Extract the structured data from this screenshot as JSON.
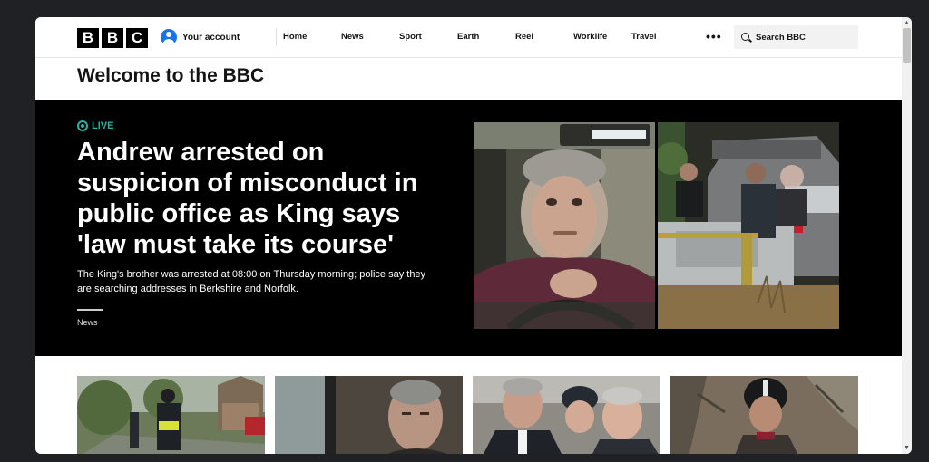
{
  "logo": {
    "letters": [
      "B",
      "B",
      "C"
    ]
  },
  "account": {
    "label": "Your account"
  },
  "nav": {
    "links": [
      "Home",
      "News",
      "Sport",
      "Earth",
      "Reel",
      "Worklife",
      "Travel"
    ],
    "more_label": "•••",
    "search_placeholder": "Search BBC"
  },
  "welcome": "Welcome to the BBC",
  "hero": {
    "live_label": "LIVE",
    "headline": "Andrew arrested on suspicion of misconduct in public office as King says 'law must take its course'",
    "summary": "The King's brother was arrested at 08:00 on Thursday morning; police say they are searching addresses in Berkshire and Norfolk.",
    "tag": "News"
  },
  "colors": {
    "live_accent": "#1fb5a7",
    "hero_bg": "#000000",
    "search_bg": "#f2f2f2"
  }
}
